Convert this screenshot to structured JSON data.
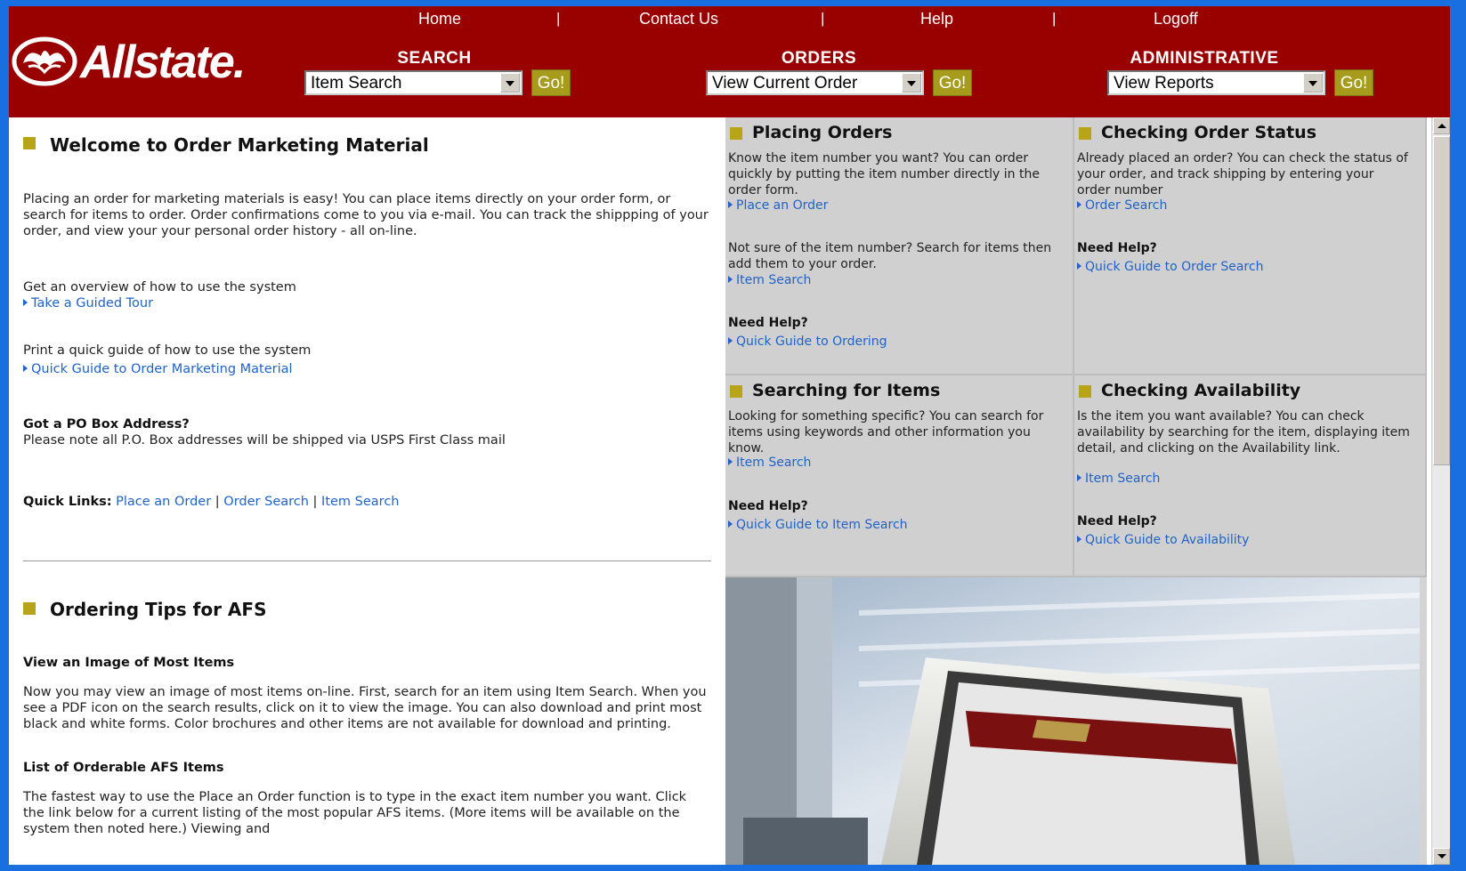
{
  "topnav": {
    "home": "Home",
    "contact": "Contact Us",
    "help": "Help",
    "logoff": "Logoff",
    "separator": "|"
  },
  "logo": {
    "text": "Allstate."
  },
  "search": {
    "label": "SEARCH",
    "selected": "Item Search",
    "go": "Go!"
  },
  "orders": {
    "label": "ORDERS",
    "selected": "View Current Order",
    "go": "Go!"
  },
  "admin": {
    "label": "ADMINISTRATIVE",
    "selected": "View Reports",
    "go": "Go!"
  },
  "welcome": {
    "title": "Welcome to Order Marketing Material",
    "intro": "Placing an order for marketing materials is easy! You can place items directly on your order form, or search for items to order. Order confirmations come to you via e-mail. You can track the shippping of your order, and view your your personal order history - all on-line.",
    "overview_text": "Get an overview of how to use the system",
    "tour_link": "Take a Guided Tour",
    "print_text": "Print a quick guide of how to use the system",
    "guide_link": "Quick Guide to Order Marketing Material",
    "po_title": "Got a PO Box Address?",
    "po_text": "Please note all P.O. Box addresses will be shipped via USPS First Class mail",
    "quick_label": "Quick Links:",
    "quick_links": [
      "Place an Order",
      "Order Search",
      "Item Search"
    ],
    "quick_sep": "|"
  },
  "tips": {
    "title": "Ordering Tips for AFS",
    "sub1": "View an Image of Most Items",
    "text1": "Now you may view an image of most items on-line. First, search for an item using Item Search. When you see a PDF icon on the search results, click on it to view the image. You can also download and print most black and white forms. Color brochures and other items are not available for download and printing.",
    "sub2": "List of Orderable AFS Items",
    "text2": "The fastest way to use the Place an Order function is to type in the exact item number you want. Click the link below for a current listing of the most popular AFS items. (More items will be available on the system then noted here.) Viewing and"
  },
  "panels": {
    "placing": {
      "title": "Placing Orders",
      "text1": "Know the item number you want? You can order quickly by putting the item number directly in the order form.",
      "link1": "Place an Order",
      "text2": "Not sure of the item number? Search for items then add them to your order.",
      "link2": "Item Search",
      "help_label": "Need Help?",
      "help_link": "Quick Guide to Ordering"
    },
    "status": {
      "title": "Checking Order Status",
      "text1": "Already placed an order? You can check the status of your order, and track shipping by entering your order number",
      "link1": "Order Search",
      "help_label": "Need Help?",
      "help_link": "Quick Guide to Order Search"
    },
    "searching": {
      "title": "Searching for Items",
      "text1": "Looking for something specific? You can search for items using keywords and other information you know.",
      "link1": "Item Search",
      "help_label": "Need Help?",
      "help_link": "Quick Guide to Item Search"
    },
    "availability": {
      "title": "Checking Availability",
      "text1": "Is the item you want available? You can check availability by searching for the item, displaying item detail, and clicking on the Availability link.",
      "link1": "Item Search",
      "help_label": "Need Help?",
      "help_link": "Quick Guide to Availability"
    }
  },
  "colors": {
    "header_bg": "#990000",
    "go_button": "#a69b1a",
    "link": "#1f63c8",
    "square_icon": "#b8a417",
    "panel_bg": "#d0d0d0",
    "window_border": "#1a6fe0"
  }
}
